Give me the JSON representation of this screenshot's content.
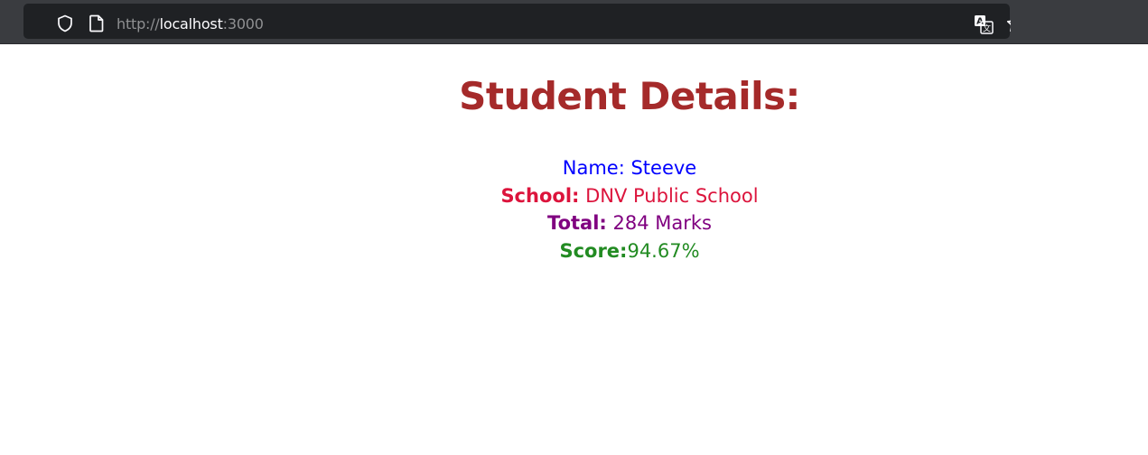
{
  "browser": {
    "url_scheme": "http://",
    "url_host": "localhost",
    "url_port": ":3000",
    "icons": [
      "shield-icon",
      "page-icon",
      "translate-icon",
      "star-icon"
    ]
  },
  "page": {
    "title": "Student Details:",
    "fields": {
      "name_label": "Name:",
      "name_value": " Steeve",
      "school_label": "School:",
      "school_value": " DNV Public School",
      "total_label": "Total:",
      "total_value": " 284 Marks",
      "score_label": "Score:",
      "score_value": "94.67%"
    }
  },
  "colors": {
    "title": "#a52a2a",
    "name": "#0000ff",
    "school": "#dc143c",
    "total": "#800080",
    "score": "#228b22"
  }
}
